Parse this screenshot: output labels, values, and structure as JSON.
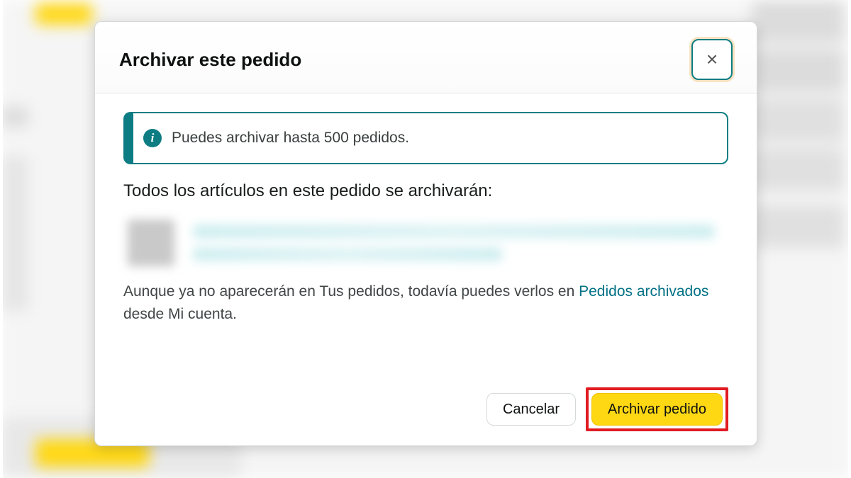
{
  "modal": {
    "title": "Archivar este pedido",
    "close_glyph": "×"
  },
  "alert": {
    "icon_glyph": "i",
    "message": "Puedes archivar hasta 500 pedidos."
  },
  "body": {
    "heading": "Todos los artículos en este pedido se archivarán:",
    "note_before": "Aunque ya no aparecerán en Tus pedidos, todavía puedes verlos en ",
    "note_link": "Pedidos archivados",
    "note_after": " desde Mi cuenta."
  },
  "buttons": {
    "cancel": "Cancelar",
    "archive": "Archivar pedido"
  }
}
